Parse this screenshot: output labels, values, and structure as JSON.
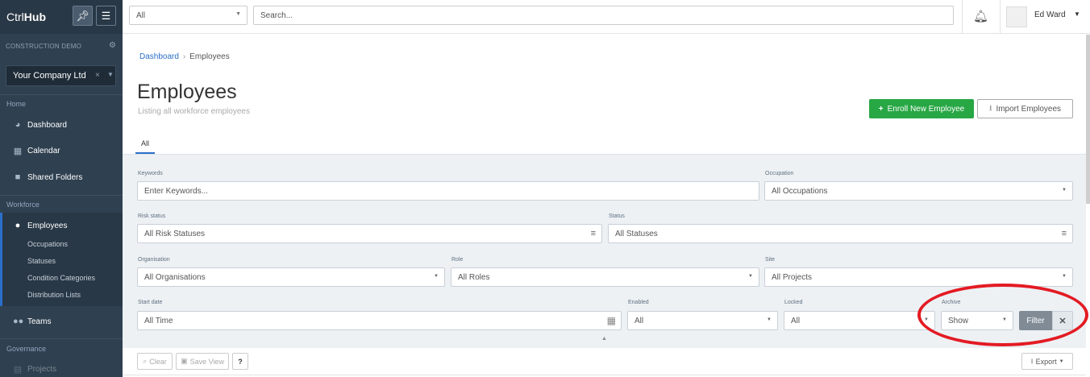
{
  "sidebar": {
    "brand_a": "Ctrl",
    "brand_b": "Hub",
    "org_heading": "CONSTRUCTION DEMO",
    "company": "Your Company Ltd",
    "section_home": "Home",
    "nav_dashboard": "Dashboard",
    "nav_calendar": "Calendar",
    "nav_shared": "Shared Folders",
    "section_workforce": "Workforce",
    "nav_employees": "Employees",
    "sub_occupations": "Occupations",
    "sub_statuses": "Statuses",
    "sub_condition": "Condition Categories",
    "sub_distribution": "Distribution Lists",
    "nav_teams": "Teams",
    "section_governance": "Governance",
    "nav_projects": "Projects"
  },
  "topbar": {
    "scope_value": "All",
    "search_placeholder": "Search...",
    "user_name": "Ed Ward"
  },
  "breadcrumb": {
    "root": "Dashboard",
    "current": "Employees"
  },
  "page": {
    "title": "Employees",
    "subtitle": "Listing all workforce employees",
    "enroll_label": "Enroll New Employee",
    "import_label": "Import Employees",
    "tab_all": "All"
  },
  "filters": {
    "keywords_label": "Keywords",
    "keywords_placeholder": "Enter Keywords...",
    "occupation_label": "Occupation",
    "occupation_value": "All Occupations",
    "risk_label": "Risk status",
    "risk_value": "All Risk Statuses",
    "status_label": "Status",
    "status_value": "All Statuses",
    "organisation_label": "Organisation",
    "organisation_value": "All Organisations",
    "role_label": "Role",
    "role_value": "All Roles",
    "site_label": "Site",
    "site_value": "All Projects",
    "start_label": "Start date",
    "start_value": "All Time",
    "enabled_label": "Enabled",
    "enabled_value": "All",
    "locked_label": "Locked",
    "locked_value": "All",
    "archive_label": "Archive",
    "archive_value": "Show",
    "filter_button": "Filter"
  },
  "toolbar": {
    "clear_label": "Clear",
    "save_view_label": "Save View",
    "help_label": "?",
    "export_label": "Export"
  },
  "colors": {
    "sidebar_bg": "#2f4050",
    "primary_green": "#28a745",
    "link_blue": "#2a6fc9",
    "annotation_red": "#e31b23"
  }
}
